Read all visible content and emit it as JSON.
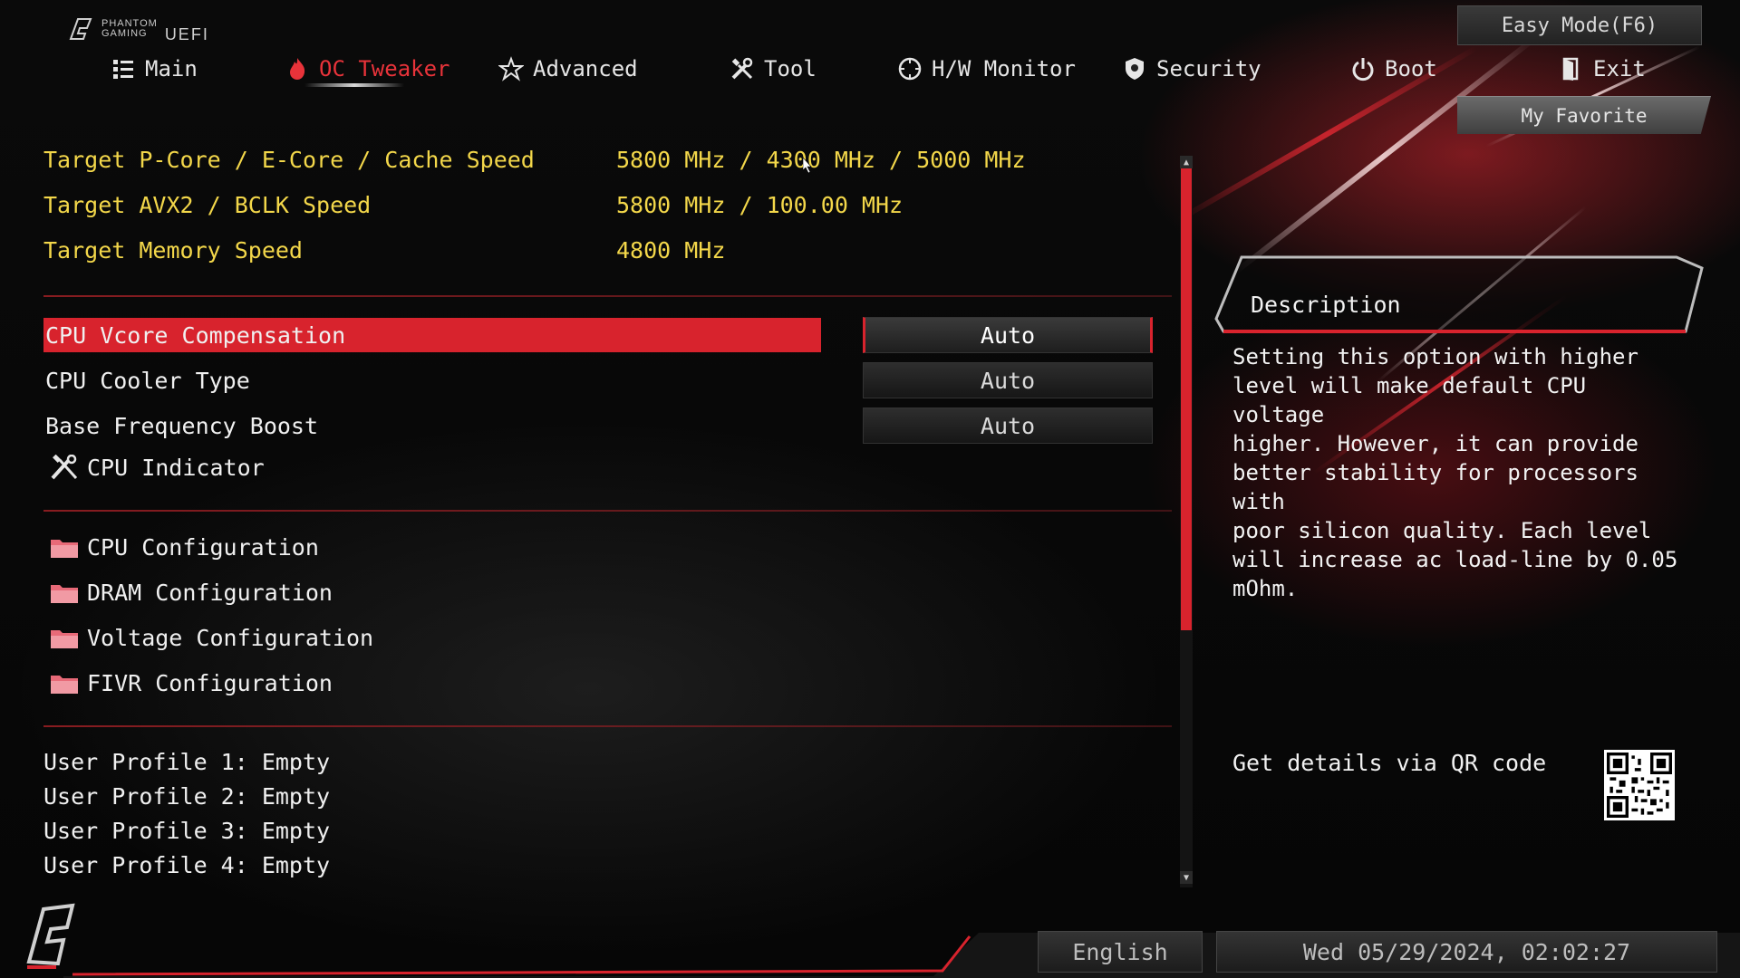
{
  "brand": {
    "line1": "PHANTOM",
    "line2": "GAMING",
    "uefi": "UEFI"
  },
  "easy_mode_label": "Easy Mode(F6)",
  "my_favorite_label": "My Favorite",
  "nav": [
    {
      "label": "Main",
      "icon": "list-icon"
    },
    {
      "label": "OC Tweaker",
      "icon": "flame-icon",
      "active": true
    },
    {
      "label": "Advanced",
      "icon": "star-icon"
    },
    {
      "label": "Tool",
      "icon": "tools-icon"
    },
    {
      "label": "H/W Monitor",
      "icon": "monitor-gauge-icon"
    },
    {
      "label": "Security",
      "icon": "shield-icon"
    },
    {
      "label": "Boot",
      "icon": "power-icon"
    },
    {
      "label": "Exit",
      "icon": "exit-door-icon"
    }
  ],
  "info": [
    {
      "label": "Target P-Core / E-Core / Cache Speed",
      "value": "5800 MHz / 4300 MHz / 5000 MHz"
    },
    {
      "label": "Target AVX2 / BCLK Speed",
      "value": "5800 MHz / 100.00 MHz"
    },
    {
      "label": "Target Memory Speed",
      "value": "4800 MHz"
    }
  ],
  "options": [
    {
      "label": "CPU Vcore Compensation",
      "value": "Auto",
      "selected": true
    },
    {
      "label": "CPU Cooler Type",
      "value": "Auto"
    },
    {
      "label": "Base Frequency Boost",
      "value": "Auto"
    }
  ],
  "cpu_indicator_label": "CPU Indicator",
  "submenus": [
    {
      "label": "CPU Configuration"
    },
    {
      "label": "DRAM Configuration"
    },
    {
      "label": "Voltage Configuration"
    },
    {
      "label": "FIVR Configuration"
    }
  ],
  "profiles": [
    "User Profile 1: Empty",
    "User Profile 2: Empty",
    "User Profile 3: Empty",
    "User Profile 4: Empty"
  ],
  "description": {
    "title": "Description",
    "text": "Setting this option with higher\nlevel will make default CPU voltage\nhigher. However, it can provide\nbetter stability for processors with\npoor silicon quality. Each level\nwill increase ac load-line by 0.05\nmOhm.",
    "qr_label": "Get details via QR code"
  },
  "footer": {
    "language": "English",
    "datetime": "Wed 05/29/2024, 02:02:27"
  },
  "colors": {
    "accent": "#d8232d",
    "info_text": "#f3d74a",
    "active_tab": "#e8333a"
  }
}
